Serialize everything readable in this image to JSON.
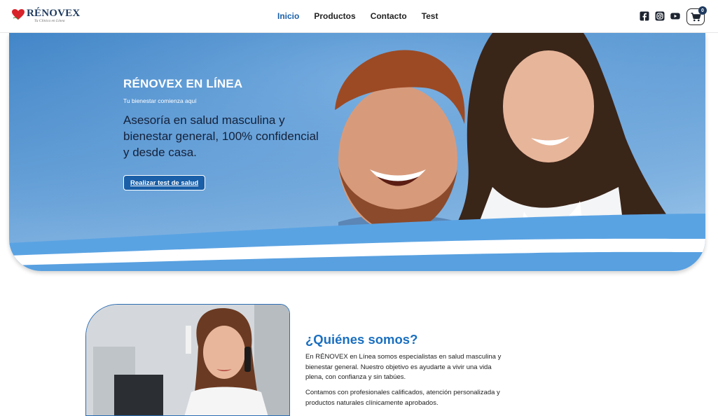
{
  "brand": {
    "name": "RÉNOVEX",
    "tagline": "Tu Clínica en Línea",
    "heart_color": "#d8232a",
    "navy": "#1e3a5f"
  },
  "nav": {
    "items": [
      {
        "label": "Inicio",
        "active": true
      },
      {
        "label": "Productos",
        "active": false
      },
      {
        "label": "Contacto",
        "active": false
      },
      {
        "label": "Test",
        "active": false
      }
    ]
  },
  "header_right": {
    "social_icons": [
      "facebook-icon",
      "instagram-icon",
      "youtube-icon"
    ],
    "cart_icon": "shopping-cart-icon",
    "cart_count": "0"
  },
  "hero": {
    "eyebrow": "RÉNOVEX EN LÍNEA",
    "subtitle": "Tu bienestar comienza aquí",
    "lead": "Asesoría en salud masculina y bienestar general, 100% confidencial y desde casa.",
    "cta_label": "Realizar test de salud",
    "accent": "#1a5fa8"
  },
  "about": {
    "title": "¿Quiénes somos?",
    "paragraph_1": "En RÉNOVEX en Línea somos especialistas en salud masculina y bienestar general. Nuestro objetivo es ayudarte a vivir una vida plena, con confianza y sin tabúes.",
    "paragraph_2": "Contamos con profesionales calificados, atención personalizada y productos naturales clínicamente aprobados.",
    "title_color": "#1a6fc0"
  }
}
